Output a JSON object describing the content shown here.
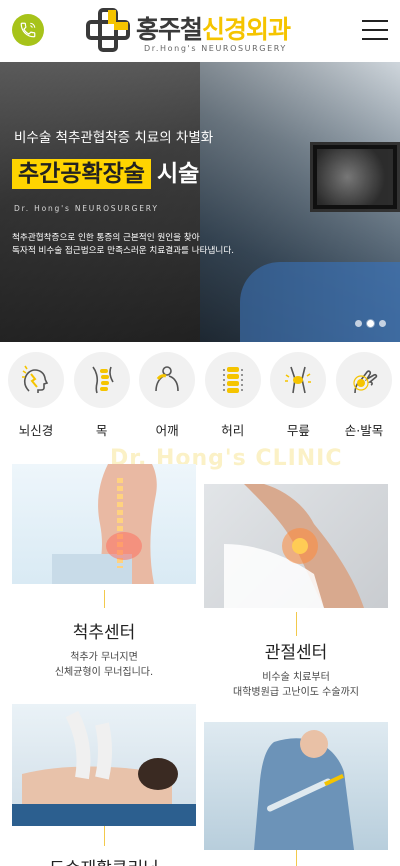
{
  "header": {
    "logo_main_dark": "홍주철",
    "logo_main_yellow": "신경외과",
    "logo_sub": "Dr.Hong's NEUROSURGERY",
    "accent_color": "#a7c31a",
    "brand_yellow": "#f5c400",
    "call_icon": "phone-icon",
    "menu_icon": "hamburger-icon"
  },
  "hero": {
    "subtitle": "비수술 척추관협착증 치료의 차별화",
    "title_highlight": "추간공확장술",
    "title_rest": "시술",
    "english": "Dr. Hong's NEUROSURGERY",
    "desc_line1": "척추관협착증으로 인한 통증의 근본적인 원인을 찾아",
    "desc_line2": "독자적 비수술 접근법으로 만족스러운 치료결과를 나타냅니다.",
    "slide_count": 3,
    "active_slide": 2
  },
  "categories": [
    {
      "label": "뇌신경",
      "icon": "brain-nerve-icon"
    },
    {
      "label": "목",
      "icon": "neck-spine-icon"
    },
    {
      "label": "어깨",
      "icon": "shoulder-icon"
    },
    {
      "label": "허리",
      "icon": "lumbar-spine-icon"
    },
    {
      "label": "무릎",
      "icon": "knee-icon"
    },
    {
      "label": "손·발목",
      "icon": "hand-wrist-icon"
    }
  ],
  "clinic": {
    "background_text": "Dr. Hong's CLINIC",
    "cards": [
      {
        "title": "척추센터",
        "desc_line1": "척추가 무너지면",
        "desc_line2": "신체균형이 무너집니다."
      },
      {
        "title": "관절센터",
        "desc_line1": "비수술 치료부터",
        "desc_line2": "대학병원급 고난이도 수술까지"
      },
      {
        "title": "도수재활클리닉"
      },
      {
        "title": ""
      }
    ]
  }
}
